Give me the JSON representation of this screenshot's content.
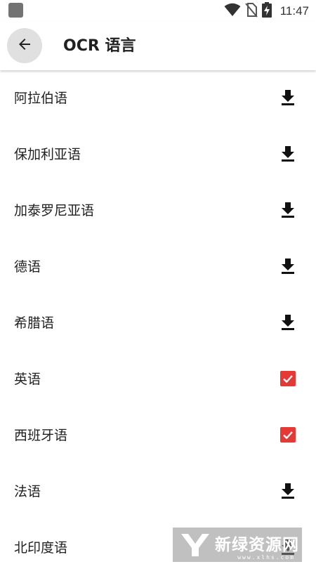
{
  "status_bar": {
    "time": "11:47",
    "icons": [
      "wifi-icon",
      "no-sim-icon",
      "battery-charging-icon"
    ]
  },
  "header": {
    "title": "OCR 语言",
    "back_icon": "arrow-back-icon"
  },
  "languages": [
    {
      "label": "阿拉伯语",
      "action": "download-icon",
      "selected": false
    },
    {
      "label": "保加利亚语",
      "action": "download-icon",
      "selected": false
    },
    {
      "label": "加泰罗尼亚语",
      "action": "download-icon",
      "selected": false
    },
    {
      "label": "德语",
      "action": "download-icon",
      "selected": false
    },
    {
      "label": "希腊语",
      "action": "download-icon",
      "selected": false
    },
    {
      "label": "英语",
      "action": "checkbox-checked-icon",
      "selected": true
    },
    {
      "label": "西班牙语",
      "action": "checkbox-checked-icon",
      "selected": true
    },
    {
      "label": "法语",
      "action": "download-icon",
      "selected": false
    },
    {
      "label": "北印度语",
      "action": "download-icon",
      "selected": false
    }
  ],
  "colors": {
    "accent": "#e53935",
    "back_button_bg": "#e0e0e0",
    "text": "#212121"
  },
  "watermark": {
    "text": "新绿资源网",
    "sub": "www.xlhs.com"
  }
}
